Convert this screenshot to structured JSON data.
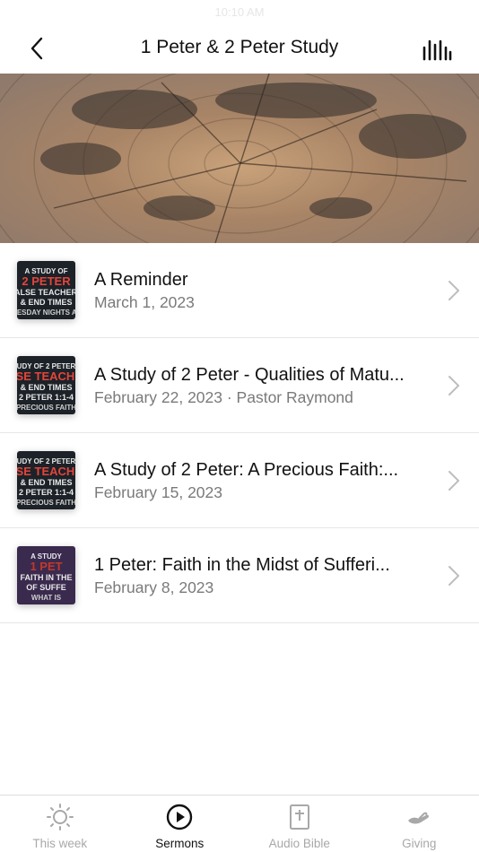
{
  "status_bar": {
    "time": "10:10 AM"
  },
  "header": {
    "title": "1 Peter & 2 Peter Study"
  },
  "sermons": [
    {
      "title": "A Reminder",
      "subtitle": "March 1, 2023",
      "thumb": {
        "lines": [
          "A STUDY OF",
          "2 PETER",
          "FALSE TEACHERS",
          "& END TIMES",
          "NESDAY NIGHTS AT"
        ],
        "bg": "#1c2228",
        "accent": "#e2453c"
      }
    },
    {
      "title": "A Study of 2 Peter - Qualities of Matu...",
      "subtitle": "February 22, 2023 · Pastor Raymond",
      "thumb": {
        "lines": [
          "UDY OF 2 PETER",
          "FALSE TEACHERS",
          "& END TIMES",
          "2 PETER 1:1-4",
          "PRECIOUS FAITH"
        ],
        "bg": "#1c2228",
        "accent": "#e2453c"
      }
    },
    {
      "title": "A Study of 2 Peter: A Precious Faith:...",
      "subtitle": "February 15, 2023",
      "thumb": {
        "lines": [
          "UDY OF 2 PETER",
          "FALSE TEACHERS",
          "& END TIMES",
          "2 PETER 1:1-4",
          "PRECIOUS FAITH"
        ],
        "bg": "#1c2228",
        "accent": "#e2453c"
      }
    },
    {
      "title": "1 Peter: Faith in the Midst of Sufferi...",
      "subtitle": "February 8, 2023",
      "thumb": {
        "lines": [
          "A STUDY",
          "1 PET",
          "FAITH IN THE",
          "OF SUFFE",
          "WHAT IS"
        ],
        "bg": "#3a2a4e",
        "accent": "#c0392b"
      }
    }
  ],
  "tabs": [
    {
      "label": "This week",
      "icon": "sun-icon",
      "active": false
    },
    {
      "label": "Sermons",
      "icon": "play-circle-icon",
      "active": true
    },
    {
      "label": "Audio Bible",
      "icon": "bible-icon",
      "active": false
    },
    {
      "label": "Giving",
      "icon": "giving-hand-icon",
      "active": false
    }
  ]
}
